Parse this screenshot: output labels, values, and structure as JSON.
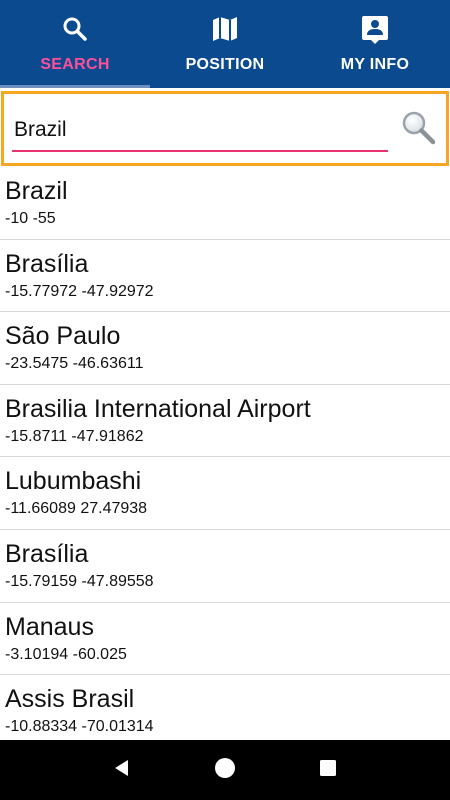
{
  "tabs": [
    {
      "label": "SEARCH",
      "icon": "search-icon",
      "active": true
    },
    {
      "label": "POSITION",
      "icon": "map-icon",
      "active": false
    },
    {
      "label": "MY INFO",
      "icon": "contact-card-icon",
      "active": false
    }
  ],
  "colors": {
    "tabbar_bg": "#0b4a8e",
    "active_tab_text": "#ff4f9a",
    "search_border": "#f6a623",
    "search_underline": "#e8336f"
  },
  "search": {
    "value": "Brazil",
    "placeholder": "",
    "button_icon": "magnifier-icon"
  },
  "results": [
    {
      "name": "Brazil",
      "coords": "-10 -55"
    },
    {
      "name": "Brasília",
      "coords": "-15.77972 -47.92972"
    },
    {
      "name": "São Paulo",
      "coords": "-23.5475 -46.63611"
    },
    {
      "name": "Brasilia International Airport",
      "coords": "-15.8711 -47.91862"
    },
    {
      "name": "Lubumbashi",
      "coords": "-11.66089 27.47938"
    },
    {
      "name": "Brasília",
      "coords": "-15.79159 -47.89558"
    },
    {
      "name": "Manaus",
      "coords": "-3.10194 -60.025"
    },
    {
      "name": "Assis Brasil",
      "coords": "-10.88334 -70.01314"
    }
  ],
  "navbar": {
    "back_icon": "back-triangle-icon",
    "home_icon": "home-circle-icon",
    "recents_icon": "recents-square-icon"
  }
}
